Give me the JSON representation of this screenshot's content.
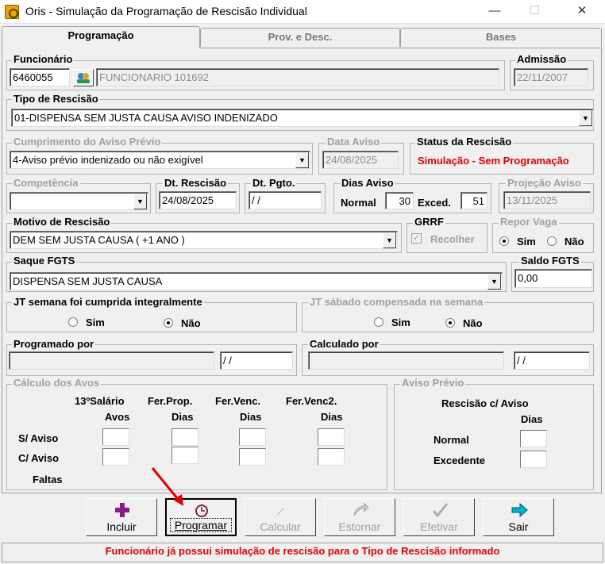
{
  "window": {
    "title": "Oris - Simulação da Programação de Rescisão Individual",
    "minimize": "—",
    "maximize": "☐",
    "close": "✕"
  },
  "tabs": [
    {
      "label": "Programação"
    },
    {
      "label": "Prov. e Desc."
    },
    {
      "label": "Bases"
    }
  ],
  "funcionario": {
    "label": "Funcionário",
    "code": "6460055",
    "name": "FUNCIONARIO 101692"
  },
  "admissao": {
    "label": "Admissão",
    "value": "22/11/2007"
  },
  "tipo_rescisao": {
    "label": "Tipo de Rescisão",
    "value": "01-DISPENSA SEM JUSTA CAUSA AVISO INDENIZADO"
  },
  "cumprimento": {
    "label": "Cumprimento do Aviso Prévio",
    "value": "4-Aviso prévio indenizado ou não exigível"
  },
  "data_aviso": {
    "label": "Data Aviso",
    "value": "24/08/2025"
  },
  "status_rescisao": {
    "label": "Status da Rescisão",
    "value": "Simulação - Sem Programação"
  },
  "competencia": {
    "label": "Competência",
    "value": ""
  },
  "dt_rescisao": {
    "label": "Dt. Rescisão",
    "value": "24/08/2025"
  },
  "dt_pgto": {
    "label": "Dt. Pgto.",
    "value": " / /"
  },
  "dias_aviso": {
    "label": "Dias Aviso",
    "normal_label": "Normal",
    "normal": "30",
    "exced_label": "Exced.",
    "exced": "51"
  },
  "projecao_aviso": {
    "label": "Projeção Aviso",
    "value": "13/11/2025"
  },
  "motivo": {
    "label": "Motivo de Rescisão",
    "value": "DEM SEM JUSTA CAUSA ( +1 ANO )"
  },
  "grrf": {
    "label": "GRRF",
    "checkbox": "Recolher"
  },
  "repor_vaga": {
    "label": "Repor Vaga",
    "sim": "Sim",
    "nao": "Não"
  },
  "saque_fgts": {
    "label": "Saque FGTS",
    "value": "DISPENSA SEM JUSTA CAUSA"
  },
  "saldo_fgts": {
    "label": "Saldo FGTS",
    "value": "0,00"
  },
  "jt_semana": {
    "label": "JT semana foi cumprida integralmente",
    "sim": "Sim",
    "nao": "Não"
  },
  "jt_sabado": {
    "label": "JT sábado compensada na semana",
    "sim": "Sim",
    "nao": "Não"
  },
  "programado_por": {
    "label": "Programado por",
    "date": " / /"
  },
  "calculado_por": {
    "label": "Calculado por",
    "date": " / /"
  },
  "calculo_avos": {
    "label": "Cálculo dos Avos",
    "col1a": "13ºSalário",
    "col1b": "Avos",
    "col2a": "Fer.Prop.",
    "col2b": "Dias",
    "col3a": "Fer.Venc.",
    "col3b": "Dias",
    "col4a": "Fer.Venc2.",
    "col4b": "Dias",
    "row1": "S/ Aviso",
    "row2": "C/ Aviso",
    "row3": "Faltas"
  },
  "aviso_previo": {
    "label": "Aviso Prévio",
    "head1": "Rescisão c/ Aviso",
    "head2": "Dias",
    "row1": "Normal",
    "row2": "Excedente"
  },
  "buttons": {
    "incluir": "Incluir",
    "programar": "Programar",
    "calcular": "Calcular",
    "estornar": "Estornar",
    "efetivar": "Efetivar",
    "sair": "Sair"
  },
  "status_bar": "Funcionário já possui simulação de rescisão para o Tipo de Rescisão informado",
  "colors": {
    "status_red": "#e00000",
    "incluir_icon": "#8b1a8b",
    "sair_icon": "#00a0c0",
    "arrow": "#e00000"
  }
}
